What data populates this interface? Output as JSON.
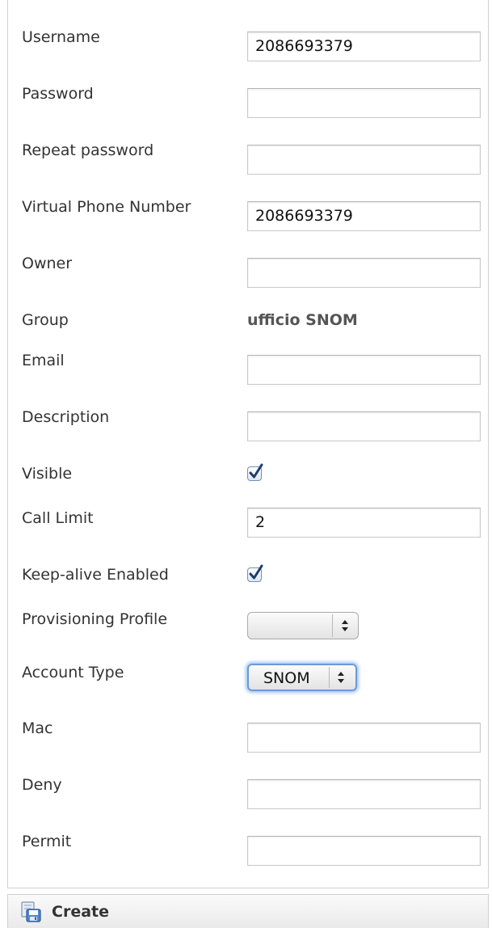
{
  "form": {
    "username": {
      "label": "Username",
      "value": "2086693379"
    },
    "password": {
      "label": "Password",
      "value": ""
    },
    "repeat_password": {
      "label": "Repeat password",
      "value": ""
    },
    "virtual_phone_number": {
      "label": "Virtual Phone Number",
      "value": "2086693379"
    },
    "owner": {
      "label": "Owner",
      "value": ""
    },
    "group": {
      "label": "Group",
      "value": "ufficio SNOM"
    },
    "email": {
      "label": "Email",
      "value": ""
    },
    "description": {
      "label": "Description",
      "value": ""
    },
    "visible": {
      "label": "Visible",
      "checked": true
    },
    "call_limit": {
      "label": "Call Limit",
      "value": "2"
    },
    "keep_alive_enabled": {
      "label": "Keep-alive Enabled",
      "checked": true
    },
    "provisioning_profile": {
      "label": "Provisioning Profile",
      "selected": ""
    },
    "account_type": {
      "label": "Account Type",
      "selected": "SNOM"
    },
    "mac": {
      "label": "Mac",
      "value": ""
    },
    "deny": {
      "label": "Deny",
      "value": ""
    },
    "permit": {
      "label": "Permit",
      "value": ""
    }
  },
  "toolbar": {
    "create_label": "Create",
    "create_icon": "save-icon"
  },
  "colors": {
    "checkbox_border": "#6f8fb8",
    "checkmark": "#1e3c72",
    "focus_ring": "#9ec3f2"
  }
}
